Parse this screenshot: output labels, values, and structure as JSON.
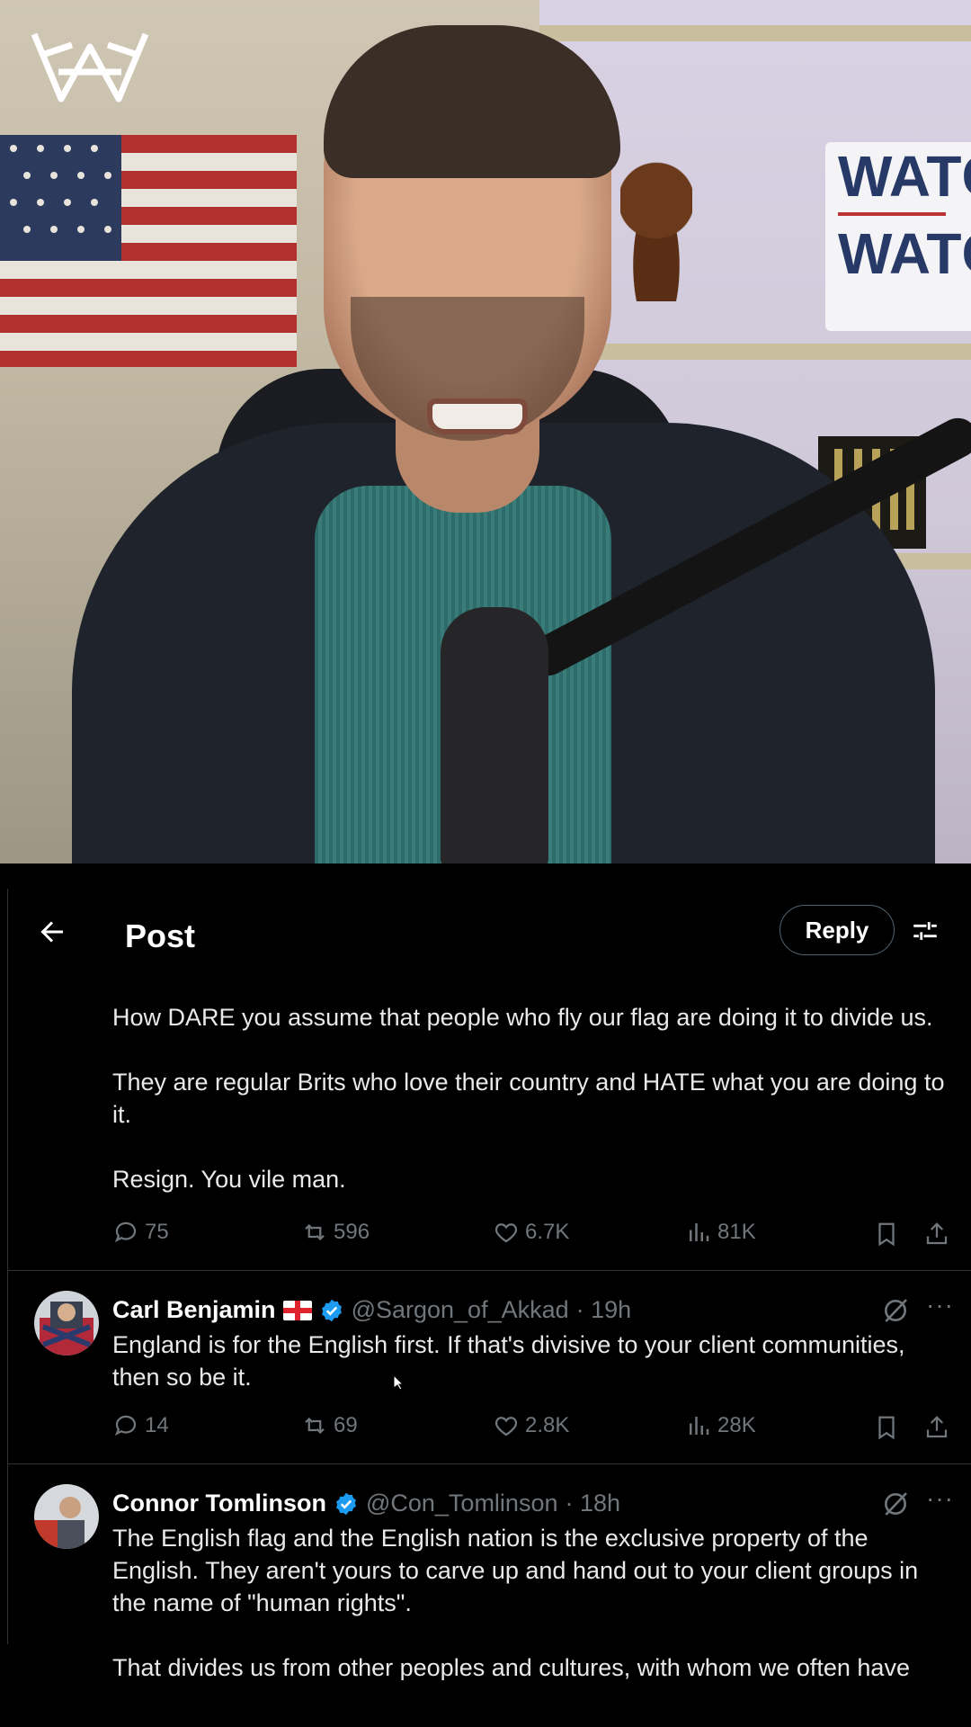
{
  "header": {
    "title": "Post",
    "reply_button": "Reply"
  },
  "background_sign": {
    "line1": "WATC",
    "line2": "WATC"
  },
  "main_post": {
    "paragraphs": [
      "How DARE you assume that people who fly our flag are doing it to divide us.",
      "They are regular Brits who love their country and HATE what you are doing to it.",
      "Resign. You vile man."
    ],
    "stats": {
      "replies": "75",
      "reposts": "596",
      "likes": "6.7K",
      "views": "81K"
    }
  },
  "replies": [
    {
      "name": "Carl Benjamin",
      "handle": "@Sargon_of_Akkad",
      "time": "· 19h",
      "text": "England is for the English first. If that's divisive to your client communities, then so be it.",
      "stats": {
        "replies": "14",
        "reposts": "69",
        "likes": "2.8K",
        "views": "28K"
      }
    },
    {
      "name": "Connor Tomlinson",
      "handle": "@Con_Tomlinson",
      "time": "· 18h",
      "text": "The English flag and the English nation is the exclusive property of the English. They aren't yours to carve up and hand out to your client groups in the name of \"human rights\".\n\nThat divides us from other peoples and cultures, with whom we often have"
    }
  ],
  "icons": {
    "back": "arrow-left-icon",
    "settings": "sliders-icon",
    "reply": "comment-icon",
    "repost": "repost-icon",
    "like": "heart-icon",
    "views": "bar-chart-icon",
    "bookmark": "bookmark-icon",
    "share": "share-icon",
    "grok": "grok-icon",
    "more": "more-icon",
    "verified": "verified-badge-icon"
  },
  "colors": {
    "background": "#000000",
    "text": "#e7e9ea",
    "muted": "#71767b",
    "verified": "#1d9bf0",
    "border": "#2f3336"
  }
}
